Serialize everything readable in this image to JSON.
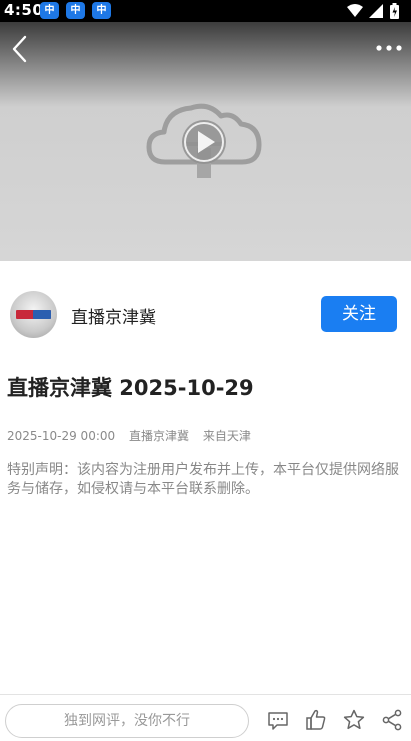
{
  "status_bar": {
    "time": "4:50",
    "notification_icons": [
      "news-app-icon",
      "news-app-icon",
      "news-app-icon"
    ],
    "notification_glyph": "中",
    "system_icons": [
      "wifi-icon",
      "signal-icon",
      "battery-icon"
    ]
  },
  "video": {
    "state": "placeholder",
    "icons": [
      "back-arrow-icon",
      "more-dots-icon",
      "cloud-play-icon"
    ]
  },
  "author": {
    "name": "直播京津冀",
    "follow_label": "关注"
  },
  "article": {
    "title": "直播京津冀 2025-10-29",
    "meta": {
      "datetime": "2025-10-29 00:00",
      "source": "直播京津冀",
      "location": "来自天津"
    },
    "disclaimer": "特别声明：该内容为注册用户发布并上传，本平台仅提供网络服务与储存，如侵权请与本平台联系删除。"
  },
  "bottom_bar": {
    "comment_placeholder": "独到网评，没你不行",
    "actions": [
      "comment-icon",
      "like-icon",
      "favorite-star-icon",
      "share-icon"
    ]
  },
  "colors": {
    "accent": "#1a7ef2",
    "status_bar": "#000000",
    "notification_badge": "#1e78e6"
  }
}
